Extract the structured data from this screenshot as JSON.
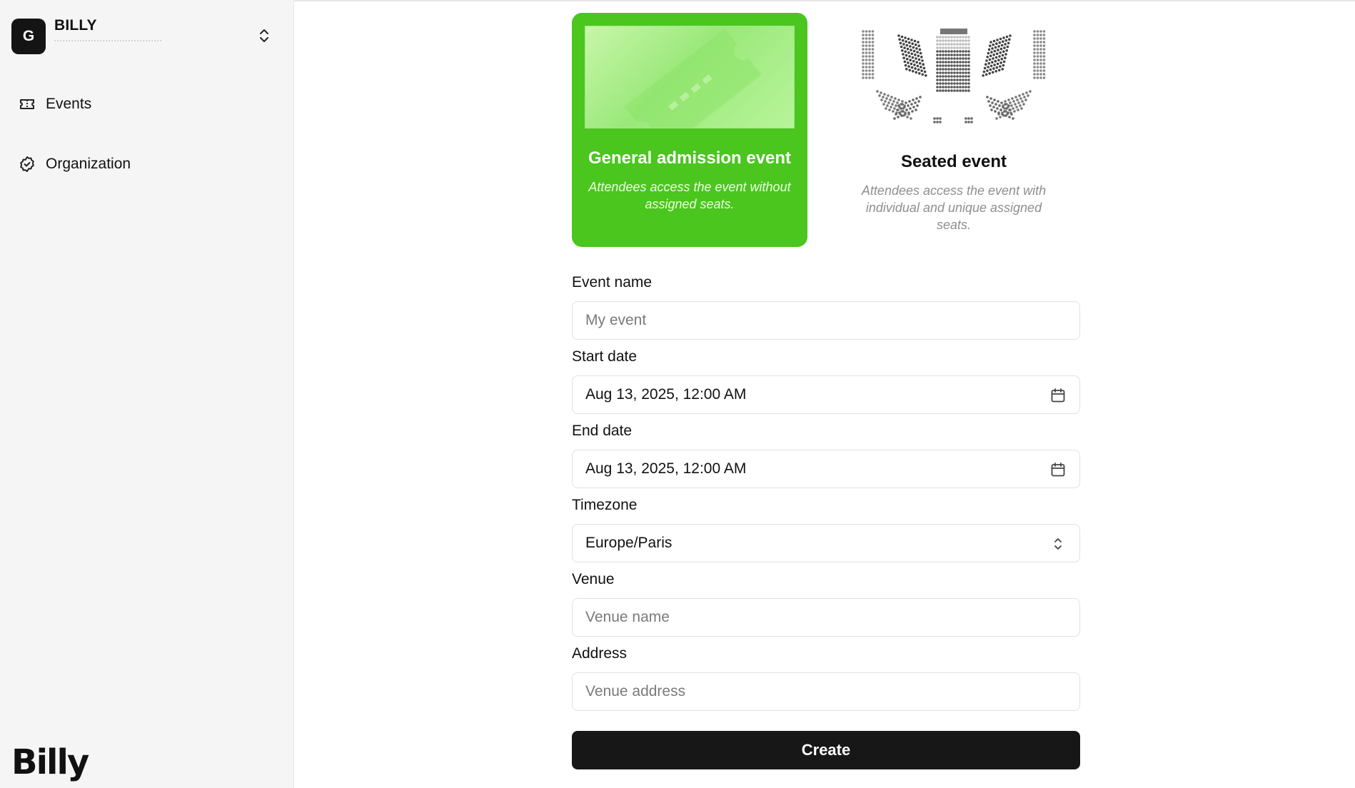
{
  "org": {
    "avatar_letter": "G",
    "name": "BILLY"
  },
  "nav": {
    "items": [
      {
        "label": "Events",
        "icon": "ticket-icon"
      },
      {
        "label": "Organization",
        "icon": "badge-check-icon"
      }
    ]
  },
  "brand": {
    "logo_text": "Billy"
  },
  "event_types": {
    "general": {
      "title": "General admission event",
      "description": "Attendees access the event without assigned seats.",
      "selected": true
    },
    "seated": {
      "title": "Seated event",
      "description": "Attendees access the event with individual and unique assigned seats.",
      "selected": false
    }
  },
  "form": {
    "event_name": {
      "label": "Event name",
      "placeholder": "My event",
      "value": ""
    },
    "start_date": {
      "label": "Start date",
      "value": "Aug 13, 2025, 12:00 AM"
    },
    "end_date": {
      "label": "End date",
      "value": "Aug 13, 2025, 12:00 AM"
    },
    "timezone": {
      "label": "Timezone",
      "value": "Europe/Paris"
    },
    "venue": {
      "label": "Venue",
      "placeholder": "Venue name",
      "value": ""
    },
    "address": {
      "label": "Address",
      "placeholder": "Venue address",
      "value": ""
    },
    "submit_label": "Create"
  },
  "colors": {
    "accent_green": "#4ac61e",
    "primary_button": "#171717",
    "sidebar_bg": "#f5f5f5"
  }
}
